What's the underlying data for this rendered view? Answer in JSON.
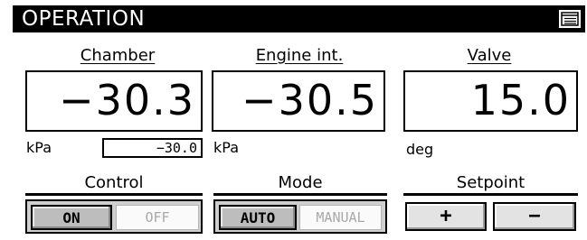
{
  "header": {
    "title": "OPERATION",
    "menu_icon": "menu-list-icon"
  },
  "readouts": {
    "chamber": {
      "label": "Chamber",
      "value": "−30.3",
      "unit": "kPa",
      "setpoint": "−30.0"
    },
    "engine": {
      "label": "Engine int.",
      "value": "−30.5",
      "unit": "kPa"
    },
    "valve": {
      "label": "Valve",
      "value": "15.0",
      "unit": "deg"
    }
  },
  "control": {
    "label": "Control",
    "on_label": "ON",
    "off_label": "OFF",
    "active": "ON"
  },
  "mode": {
    "label": "Mode",
    "auto_label": "AUTO",
    "manual_label": "MANUAL",
    "active": "AUTO"
  },
  "setpoint": {
    "label": "Setpoint",
    "plus_label": "+",
    "minus_label": "−"
  }
}
